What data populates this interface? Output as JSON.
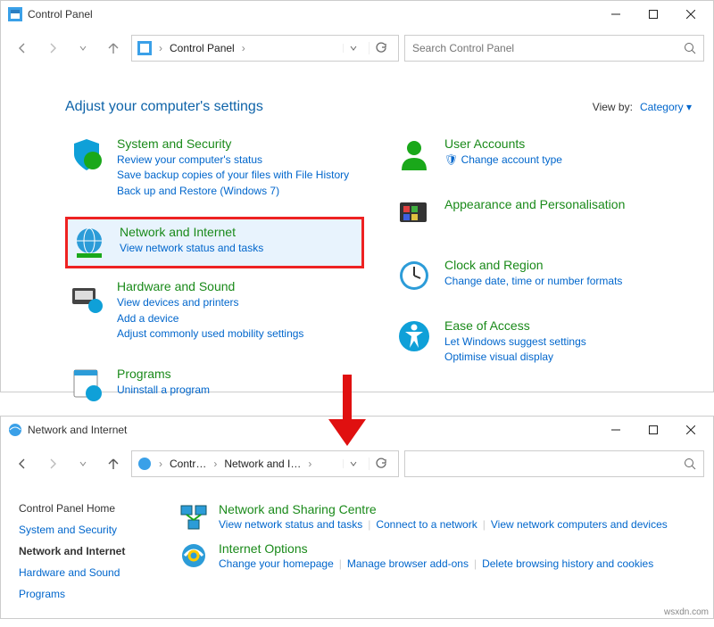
{
  "win1": {
    "title": "Control Panel",
    "address": [
      "Control Panel"
    ],
    "search_placeholder": "Search Control Panel",
    "headline": "Adjust your computer's settings",
    "viewby_label": "View by:",
    "viewby_value": "Category",
    "left": [
      {
        "name": "system-security",
        "title": "System and Security",
        "links": [
          "Review your computer's status",
          "Save backup copies of your files with File History",
          "Back up and Restore (Windows 7)"
        ]
      },
      {
        "name": "network-internet",
        "title": "Network and Internet",
        "links": [
          "View network status and tasks"
        ],
        "highlight": true
      },
      {
        "name": "hardware-sound",
        "title": "Hardware and Sound",
        "links": [
          "View devices and printers",
          "Add a device",
          "Adjust commonly used mobility settings"
        ]
      },
      {
        "name": "programs",
        "title": "Programs",
        "links": [
          "Uninstall a program"
        ]
      }
    ],
    "right": [
      {
        "name": "user-accounts",
        "title": "User Accounts",
        "links": [
          "Change account type"
        ],
        "badge": "🛡"
      },
      {
        "name": "appearance",
        "title": "Appearance and Personalisation",
        "links": []
      },
      {
        "name": "clock-region",
        "title": "Clock and Region",
        "links": [
          "Change date, time or number formats"
        ]
      },
      {
        "name": "ease-of-access",
        "title": "Ease of Access",
        "links": [
          "Let Windows suggest settings",
          "Optimise visual display"
        ]
      }
    ]
  },
  "win2": {
    "title": "Network and Internet",
    "address": [
      "Contr…",
      "Network and I…"
    ],
    "sidenav": [
      {
        "label": "Control Panel Home",
        "cls": "heading"
      },
      {
        "label": "System and Security",
        "cls": ""
      },
      {
        "label": "Network and Internet",
        "cls": "active"
      },
      {
        "label": "Hardware and Sound",
        "cls": ""
      },
      {
        "label": "Programs",
        "cls": ""
      }
    ],
    "items": [
      {
        "title": "Network and Sharing Centre",
        "links": [
          "View network status and tasks",
          "Connect to a network",
          "View network computers and devices"
        ]
      },
      {
        "title": "Internet Options",
        "links": [
          "Change your homepage",
          "Manage browser add-ons",
          "Delete browsing history and cookies"
        ]
      }
    ]
  },
  "watermark": "wsxdn.com"
}
